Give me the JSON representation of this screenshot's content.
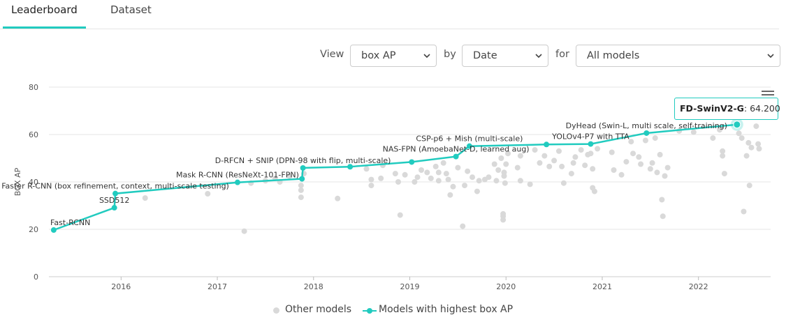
{
  "tabs": [
    {
      "label": "Leaderboard",
      "active": true
    },
    {
      "label": "Dataset",
      "active": false
    }
  ],
  "controls": {
    "view_label": "View",
    "view_value": "box AP",
    "by_label": "by",
    "by_value": "Date",
    "for_label": "for",
    "for_value": "All models"
  },
  "colors": {
    "accent": "#21cbbf",
    "other_points": "#d9d9d9"
  },
  "icons": {
    "menu": "hamburger-menu-icon",
    "chevron": "chevron-down-icon"
  },
  "tooltip": {
    "name": "FD-SwinV2-G",
    "separator": ":",
    "value": "64.200"
  },
  "chart_data": {
    "type": "scatter",
    "title": "",
    "xlabel": "",
    "ylabel": "BOX AP",
    "x_ticks": [
      "2016",
      "2017",
      "2018",
      "2019",
      "2020",
      "2021",
      "2022"
    ],
    "y_ticks": [
      0,
      20,
      40,
      60,
      80
    ],
    "xlim": [
      2015.25,
      2022.75
    ],
    "ylim": [
      0,
      80
    ],
    "grid": true,
    "legend": {
      "position": "bottom",
      "entries": [
        "Other models",
        "Models with highest box AP"
      ]
    },
    "series": [
      {
        "name": "Models with highest box AP",
        "points": [
          {
            "x": 2015.3,
            "y": 19.7,
            "label": "Fast-RCNN"
          },
          {
            "x": 2015.93,
            "y": 29.1,
            "label": "SSD512"
          },
          {
            "x": 2015.94,
            "y": 35.1,
            "label": "Faster R-CNN (box refinement, context, multi-scale testing)"
          },
          {
            "x": 2017.21,
            "y": 39.8,
            "label": "Mask R-CNN (ResNeXt-101-FPN)"
          },
          {
            "x": 2017.88,
            "y": 41.3
          },
          {
            "x": 2017.89,
            "y": 45.9,
            "label": "D-RFCN + SNIP (DPN-98 with flip, multi-scale)"
          },
          {
            "x": 2018.38,
            "y": 46.4
          },
          {
            "x": 2019.02,
            "y": 48.4
          },
          {
            "x": 2019.48,
            "y": 50.7,
            "label": "NAS-FPN (AmoebaNet-D, learned aug)"
          },
          {
            "x": 2019.62,
            "y": 55.1,
            "label": "CSP-p6 + Mish (multi-scale)"
          },
          {
            "x": 2020.42,
            "y": 55.8
          },
          {
            "x": 2020.88,
            "y": 56.0,
            "label": "YOLOv4-P7 with TTA"
          },
          {
            "x": 2021.46,
            "y": 60.6,
            "label": "DyHead (Swin-L, multi scale, self-training)"
          },
          {
            "x": 2022.4,
            "y": 64.2,
            "label": "FD-SwinV2-G"
          }
        ]
      },
      {
        "name": "Other models",
        "points": [
          {
            "x": 2016.25,
            "y": 33.2
          },
          {
            "x": 2016.9,
            "y": 35.0
          },
          {
            "x": 2017.28,
            "y": 19.2
          },
          {
            "x": 2017.35,
            "y": 39.5
          },
          {
            "x": 2017.5,
            "y": 40.5
          },
          {
            "x": 2017.6,
            "y": 41.5
          },
          {
            "x": 2017.65,
            "y": 40.0
          },
          {
            "x": 2017.75,
            "y": 42.5
          },
          {
            "x": 2017.87,
            "y": 33.5
          },
          {
            "x": 2017.87,
            "y": 36.5
          },
          {
            "x": 2017.87,
            "y": 38.5
          },
          {
            "x": 2017.9,
            "y": 43.5
          },
          {
            "x": 2018.25,
            "y": 33.0
          },
          {
            "x": 2018.55,
            "y": 45.5
          },
          {
            "x": 2018.6,
            "y": 41.0
          },
          {
            "x": 2018.6,
            "y": 38.5
          },
          {
            "x": 2018.7,
            "y": 41.5
          },
          {
            "x": 2018.72,
            "y": 47.0
          },
          {
            "x": 2018.85,
            "y": 43.5
          },
          {
            "x": 2018.88,
            "y": 40.0
          },
          {
            "x": 2018.9,
            "y": 26.0
          },
          {
            "x": 2018.95,
            "y": 43.0
          },
          {
            "x": 2019.05,
            "y": 40.0
          },
          {
            "x": 2019.08,
            "y": 42.0
          },
          {
            "x": 2019.12,
            "y": 45.0
          },
          {
            "x": 2019.18,
            "y": 44.0
          },
          {
            "x": 2019.22,
            "y": 41.5
          },
          {
            "x": 2019.27,
            "y": 46.5
          },
          {
            "x": 2019.3,
            "y": 44.0
          },
          {
            "x": 2019.3,
            "y": 40.5
          },
          {
            "x": 2019.35,
            "y": 48.0
          },
          {
            "x": 2019.38,
            "y": 43.5
          },
          {
            "x": 2019.4,
            "y": 41.0
          },
          {
            "x": 2019.42,
            "y": 34.5
          },
          {
            "x": 2019.45,
            "y": 38.0
          },
          {
            "x": 2019.5,
            "y": 46.0
          },
          {
            "x": 2019.55,
            "y": 21.3
          },
          {
            "x": 2019.57,
            "y": 38.5
          },
          {
            "x": 2019.6,
            "y": 44.5
          },
          {
            "x": 2019.65,
            "y": 42.0
          },
          {
            "x": 2019.7,
            "y": 36.0
          },
          {
            "x": 2019.72,
            "y": 40.5
          },
          {
            "x": 2019.78,
            "y": 41.0
          },
          {
            "x": 2019.82,
            "y": 42.0
          },
          {
            "x": 2019.88,
            "y": 47.5
          },
          {
            "x": 2019.9,
            "y": 40.5
          },
          {
            "x": 2019.92,
            "y": 45.0
          },
          {
            "x": 2019.95,
            "y": 50.0
          },
          {
            "x": 2019.97,
            "y": 24.0
          },
          {
            "x": 2019.97,
            "y": 25.5
          },
          {
            "x": 2019.97,
            "y": 26.5
          },
          {
            "x": 2019.98,
            "y": 44.0
          },
          {
            "x": 2019.98,
            "y": 42.5
          },
          {
            "x": 2019.99,
            "y": 39.5
          },
          {
            "x": 2020.0,
            "y": 47.5
          },
          {
            "x": 2020.02,
            "y": 52.0
          },
          {
            "x": 2020.12,
            "y": 46.0
          },
          {
            "x": 2020.15,
            "y": 51.0
          },
          {
            "x": 2020.15,
            "y": 40.5
          },
          {
            "x": 2020.25,
            "y": 39.0
          },
          {
            "x": 2020.3,
            "y": 53.5
          },
          {
            "x": 2020.35,
            "y": 48.0
          },
          {
            "x": 2020.4,
            "y": 51.0
          },
          {
            "x": 2020.45,
            "y": 46.5
          },
          {
            "x": 2020.5,
            "y": 49.0
          },
          {
            "x": 2020.55,
            "y": 53.0
          },
          {
            "x": 2020.58,
            "y": 46.5
          },
          {
            "x": 2020.6,
            "y": 39.5
          },
          {
            "x": 2020.68,
            "y": 43.5
          },
          {
            "x": 2020.7,
            "y": 48.0
          },
          {
            "x": 2020.72,
            "y": 50.5
          },
          {
            "x": 2020.78,
            "y": 53.5
          },
          {
            "x": 2020.82,
            "y": 47.0
          },
          {
            "x": 2020.85,
            "y": 51.5
          },
          {
            "x": 2020.88,
            "y": 52.0
          },
          {
            "x": 2020.9,
            "y": 45.5
          },
          {
            "x": 2020.9,
            "y": 37.5
          },
          {
            "x": 2020.92,
            "y": 36.0
          },
          {
            "x": 2020.95,
            "y": 54.0
          },
          {
            "x": 2021.1,
            "y": 52.5
          },
          {
            "x": 2021.12,
            "y": 45.0
          },
          {
            "x": 2021.2,
            "y": 43.0
          },
          {
            "x": 2021.25,
            "y": 48.5
          },
          {
            "x": 2021.3,
            "y": 57.0
          },
          {
            "x": 2021.32,
            "y": 52.0
          },
          {
            "x": 2021.38,
            "y": 50.5
          },
          {
            "x": 2021.4,
            "y": 47.5
          },
          {
            "x": 2021.45,
            "y": 57.5
          },
          {
            "x": 2021.5,
            "y": 45.5
          },
          {
            "x": 2021.52,
            "y": 48.0
          },
          {
            "x": 2021.55,
            "y": 58.5
          },
          {
            "x": 2021.57,
            "y": 44.0
          },
          {
            "x": 2021.6,
            "y": 51.5
          },
          {
            "x": 2021.62,
            "y": 32.5
          },
          {
            "x": 2021.63,
            "y": 25.5
          },
          {
            "x": 2021.65,
            "y": 42.5
          },
          {
            "x": 2021.68,
            "y": 46.0
          },
          {
            "x": 2021.8,
            "y": 61.5
          },
          {
            "x": 2021.95,
            "y": 61.0
          },
          {
            "x": 2022.15,
            "y": 58.5
          },
          {
            "x": 2022.22,
            "y": 62.0
          },
          {
            "x": 2022.25,
            "y": 51.0
          },
          {
            "x": 2022.25,
            "y": 53.0
          },
          {
            "x": 2022.27,
            "y": 43.5
          },
          {
            "x": 2022.42,
            "y": 60.5
          },
          {
            "x": 2022.45,
            "y": 58.5
          },
          {
            "x": 2022.47,
            "y": 27.5
          },
          {
            "x": 2022.5,
            "y": 51.0
          },
          {
            "x": 2022.52,
            "y": 56.5
          },
          {
            "x": 2022.53,
            "y": 38.5
          },
          {
            "x": 2022.55,
            "y": 54.5
          },
          {
            "x": 2022.6,
            "y": 63.5
          },
          {
            "x": 2022.62,
            "y": 56.0
          },
          {
            "x": 2022.63,
            "y": 54.0
          }
        ]
      }
    ]
  }
}
